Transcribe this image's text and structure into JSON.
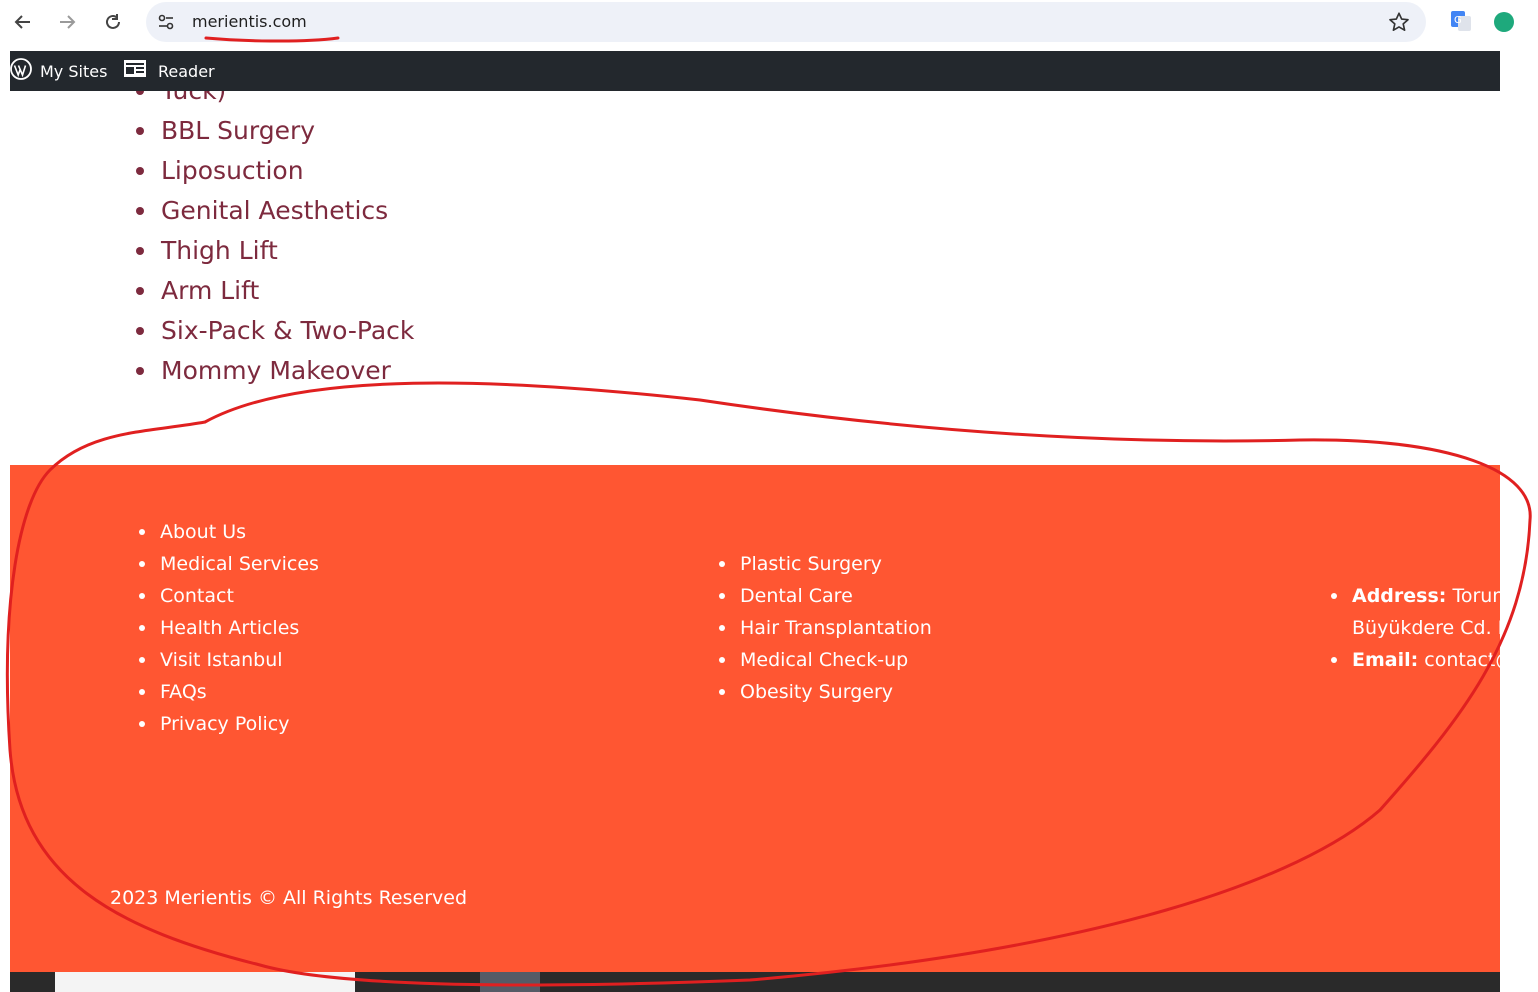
{
  "browser": {
    "url": "merientis.com",
    "icons": [
      "back-arrow-icon",
      "forward-arrow-icon",
      "reload-icon",
      "site-info-icon",
      "bookmark-star-icon",
      "google-translate-icon",
      "extension-icon"
    ]
  },
  "wp_admin_bar": {
    "my_sites_label": "My Sites",
    "reader_label": "Reader",
    "icons": [
      "wordpress-logo-icon",
      "reader-icon"
    ]
  },
  "services": {
    "partial_item": "Tuck)",
    "items": [
      "BBL Surgery",
      "Liposuction",
      "Genital Aesthetics",
      "Thigh Lift",
      "Arm Lift",
      "Six-Pack & Two-Pack",
      "Mommy Makeover"
    ]
  },
  "footer": {
    "links": [
      "About Us",
      "Medical Services",
      "Contact",
      "Health Articles",
      "Visit Istanbul",
      "FAQs",
      "Privacy Policy"
    ],
    "services": [
      "Plastic Surgery",
      "Dental Care",
      "Hair Transplantation",
      "Medical Check-up",
      "Obesity Surgery"
    ],
    "contact": {
      "address_label": "Address:",
      "address_line1": "Torun C",
      "address_line2": "Büyükdere Cd. N",
      "email_label": "Email:",
      "email_value": "contact@"
    },
    "copyright": "2023 Merientis © All Rights Reserved"
  },
  "colors": {
    "footer_bg": "#ff5632",
    "service_text": "#7d2a3e",
    "admin_bar_bg": "#23282d",
    "annotation": "#e02020"
  }
}
